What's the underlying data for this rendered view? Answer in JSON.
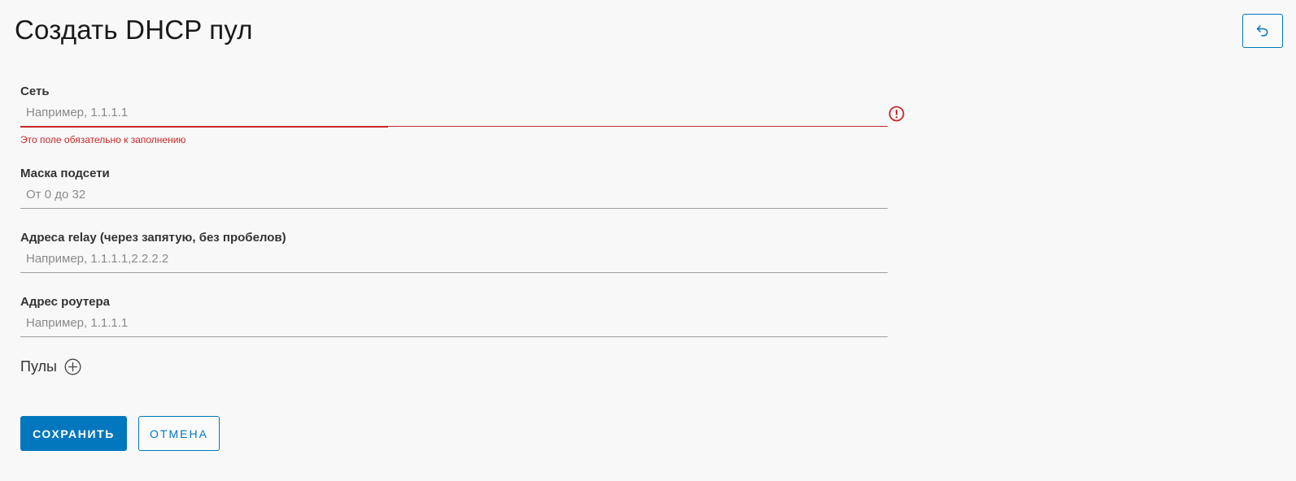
{
  "header": {
    "title": "Создать DHCP пул",
    "back_icon": "undo-arrow-icon"
  },
  "form": {
    "network": {
      "label": "Сеть",
      "placeholder": "Например, 1.1.1.1",
      "value": "",
      "error": "Это поле обязательно к заполнению",
      "error_icon": "exclamation-circle-icon"
    },
    "subnet_mask": {
      "label": "Маска подсети",
      "placeholder": "От 0 до 32",
      "value": ""
    },
    "relay_addresses": {
      "label": "Адреса relay (через запятую, без пробелов)",
      "placeholder": "Например, 1.1.1.1,2.2.2.2",
      "value": ""
    },
    "router_address": {
      "label": "Адрес роутера",
      "placeholder": "Например, 1.1.1.1",
      "value": ""
    },
    "pools": {
      "label": "Пулы",
      "add_icon": "plus-circle-icon"
    }
  },
  "actions": {
    "save_label": "СОХРАНИТЬ",
    "cancel_label": "ОТМЕНА"
  },
  "colors": {
    "accent": "#0277bd",
    "error": "#c62828",
    "background": "#f8f8f8"
  }
}
